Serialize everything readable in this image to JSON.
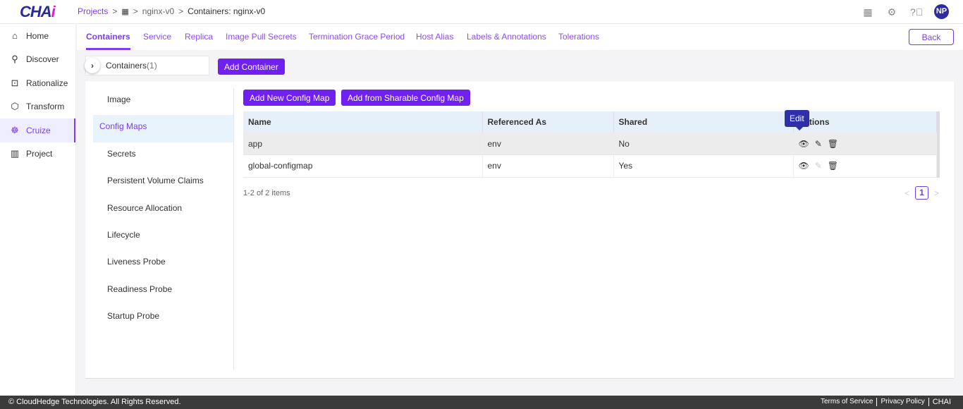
{
  "brand": {
    "logo_main": "CHA",
    "logo_accent": "i"
  },
  "breadcrumb": {
    "projects": "Projects",
    "sep": ">",
    "project": "nginx-v0",
    "current": "Containers: nginx-v0"
  },
  "user": {
    "initials": "NP"
  },
  "sidebar": {
    "items": [
      {
        "label": "Home",
        "icon": "⌂"
      },
      {
        "label": "Discover",
        "icon": "⚲"
      },
      {
        "label": "Rationalize",
        "icon": "⊡"
      },
      {
        "label": "Transform",
        "icon": "⬡"
      },
      {
        "label": "Cruize",
        "icon": "☸"
      },
      {
        "label": "Project",
        "icon": "▥"
      }
    ]
  },
  "tabs": [
    "Containers",
    "Service",
    "Replica",
    "Image Pull Secrets",
    "Termination Grace Period",
    "Host Alias",
    "Labels & Annotations",
    "Tolerations"
  ],
  "back_label": "Back",
  "containers": {
    "label": "Containers",
    "count": "(1)",
    "add_label": "Add Container"
  },
  "left_menu": [
    "Image",
    "Config Maps",
    "Secrets",
    "Persistent Volume Claims",
    "Resource Allocation",
    "Lifecycle",
    "Liveness Probe",
    "Readiness Probe",
    "Startup Probe"
  ],
  "buttons": {
    "add_new": "Add New Config Map",
    "add_sharable": "Add from Sharable Config Map"
  },
  "table": {
    "headers": [
      "Name",
      "Referenced As",
      "Shared",
      "Actions"
    ],
    "rows": [
      {
        "name": "app",
        "ref": "env",
        "shared": "No"
      },
      {
        "name": "global-configmap",
        "ref": "env",
        "shared": "Yes"
      }
    ]
  },
  "tooltip": "Edit",
  "pagination": {
    "summary": "1-2 of 2 items",
    "current": "1",
    "prev": "<",
    "next": ">"
  },
  "footer": {
    "copyright": "© CloudHedge Technologies. All Rights Reserved.",
    "links": [
      "Terms of Service",
      "Privacy Policy",
      "CHAI"
    ]
  }
}
